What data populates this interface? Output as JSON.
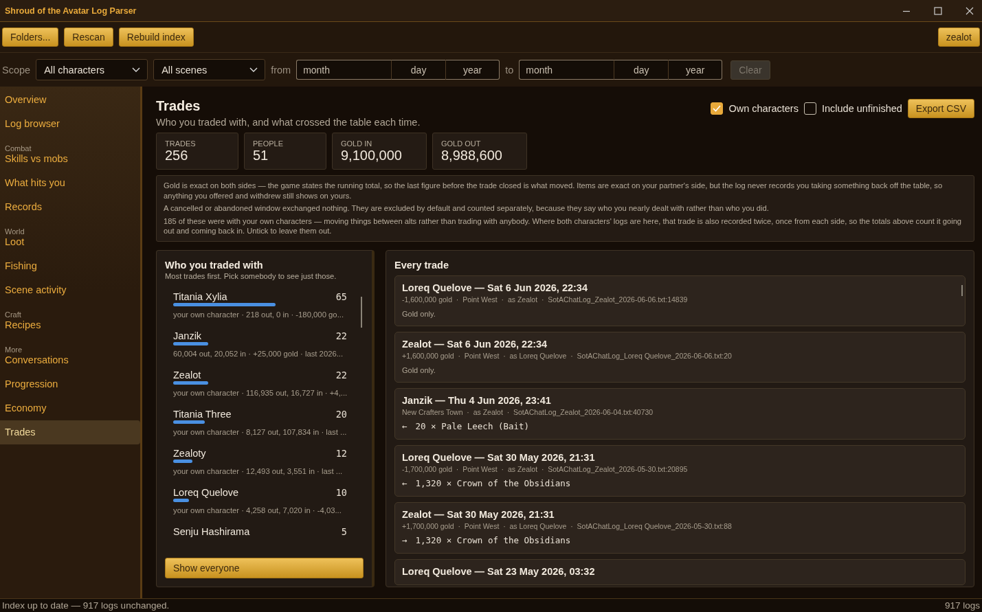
{
  "window": {
    "title": "Shroud of the Avatar Log Parser"
  },
  "toolbar": {
    "buttons": [
      "Folders...",
      "Rescan",
      "Rebuild index"
    ],
    "user_button": "zealot"
  },
  "filters": {
    "scope_label": "Scope",
    "character_select": "All characters",
    "scene_select": "All scenes",
    "from_label": "from",
    "from_date": {
      "month_placeholder": "month",
      "day_placeholder": "day",
      "year_placeholder": "year"
    },
    "to_label": "to",
    "to_date": {
      "month_placeholder": "month",
      "day_placeholder": "day",
      "year_placeholder": "year"
    },
    "clear_button": "Clear",
    "clear_disabled": true
  },
  "sidebar": {
    "items": [
      {
        "label": "Overview",
        "selected": false
      },
      {
        "label": "Log browser",
        "selected": false
      },
      {
        "group": "Combat",
        "label": "Skills vs mobs",
        "selected": false
      },
      {
        "label": "What hits you",
        "selected": false
      },
      {
        "label": "Records",
        "selected": false
      },
      {
        "group": "World",
        "label": "Loot",
        "selected": false
      },
      {
        "label": "Fishing",
        "selected": false
      },
      {
        "label": "Scene activity",
        "selected": false
      },
      {
        "group": "Craft",
        "label": "Recipes",
        "selected": false
      },
      {
        "group": "More",
        "label": "Conversations",
        "selected": false
      },
      {
        "label": "Progression",
        "selected": false
      },
      {
        "label": "Economy",
        "selected": false
      },
      {
        "label": "Trades",
        "selected": true
      }
    ]
  },
  "page": {
    "title": "Trades",
    "subtitle": "Who you traded with, and what crossed the table each time.",
    "options": [
      {
        "label": "Own characters",
        "checked": true
      },
      {
        "label": "Include unfinished",
        "checked": false
      }
    ],
    "export_button": "Export CSV",
    "stats": [
      {
        "label": "TRADES",
        "value": "256"
      },
      {
        "label": "PEOPLE",
        "value": "51"
      },
      {
        "label": "GOLD IN",
        "value": "9,100,000"
      },
      {
        "label": "GOLD OUT",
        "value": "8,988,600"
      }
    ],
    "notes": [
      "Gold is exact on both sides — the game states the running total, so the last figure before the trade closed is what moved. Items are exact on your partner's side, but the log never records you taking something back off the table, so anything you offered and withdrew still shows on yours.",
      "A cancelled or abandoned window exchanged nothing. They are excluded by default and counted separately, because they say who you nearly dealt with rather than who you did.",
      "185 of these were with your own characters — moving things between alts rather than trading with anybody. Where both characters' logs are here, that trade is also recorded twice, once from each side, so the totals above count it going out and coming back in. Untick to leave them out."
    ]
  },
  "partners": {
    "title": "Who you traded with",
    "subtitle": "Most trades first. Pick somebody to see just those.",
    "show_button": "Show everyone",
    "rows": [
      {
        "name": "Titania Xylia",
        "count": "65",
        "level": 0.59,
        "detail": "your own character  ·  218 out, 0 in  ·  -180,000 go..."
      },
      {
        "name": "Janzik",
        "count": "22",
        "level": 0.2,
        "detail": "60,004 out, 20,052 in  ·  +25,000 gold  ·  last 2026..."
      },
      {
        "name": "Zealot",
        "count": "22",
        "level": 0.2,
        "detail": "your own character  ·  116,935 out, 16,727 in  ·  +4,..."
      },
      {
        "name": "Titania Three",
        "count": "20",
        "level": 0.18,
        "detail": "your own character  ·  8,127 out, 107,834 in  ·  last ..."
      },
      {
        "name": "Zealoty",
        "count": "12",
        "level": 0.11,
        "detail": "your own character  ·  12,493 out, 3,551 in  ·  last ..."
      },
      {
        "name": "Loreq Quelove",
        "count": "10",
        "level": 0.09,
        "detail": "your own character  ·  4,258 out, 7,020 in  ·  -4,03..."
      },
      {
        "name": "Senju Hashirama",
        "count": "5"
      }
    ]
  },
  "trades": {
    "title": "Every trade",
    "cards": [
      {
        "heading": "Loreq Quelove — Sat 6 Jun 2026, 22:34",
        "meta": "-1,600,000 gold  ·  Point West  ·  as Zealot  ·  SotAChatLog_Zealot_2026-06-06.txt:14839",
        "lines": [
          {
            "kind": "note",
            "text": "Gold only."
          }
        ]
      },
      {
        "heading": "Zealot — Sat 6 Jun 2026, 22:34",
        "meta": "+1,600,000 gold  ·  Point West  ·  as Loreq Quelove  ·  SotAChatLog_Loreq Quelove_2026-06-06.txt:20",
        "lines": [
          {
            "kind": "note",
            "text": "Gold only."
          }
        ]
      },
      {
        "heading": "Janzik — Thu 4 Jun 2026, 23:41",
        "meta": "New Crafters Town  ·  as Zealot  ·  SotAChatLog_Zealot_2026-06-04.txt:40730",
        "lines": [
          {
            "kind": "item",
            "arrow": "←",
            "text": "20 × Pale Leech (Bait)"
          }
        ]
      },
      {
        "heading": "Loreq Quelove — Sat 30 May 2026, 21:31",
        "meta": "-1,700,000 gold  ·  Point West  ·  as Zealot  ·  SotAChatLog_Zealot_2026-05-30.txt:20895",
        "lines": [
          {
            "kind": "item",
            "arrow": "←",
            "text": "1,320 × Crown of the Obsidians"
          }
        ]
      },
      {
        "heading": "Zealot — Sat 30 May 2026, 21:31",
        "meta": "+1,700,000 gold  ·  Point West  ·  as Loreq Quelove  ·  SotAChatLog_Loreq Quelove_2026-05-30.txt:88",
        "lines": [
          {
            "kind": "item",
            "arrow": "→",
            "text": "1,320 × Crown of the Obsidians"
          }
        ]
      },
      {
        "heading": "Loreq Quelove — Sat 23 May 2026, 03:32"
      }
    ]
  },
  "status_bar": {
    "left": "Index up to date — 917 logs unchanged.",
    "right": "917 logs"
  }
}
